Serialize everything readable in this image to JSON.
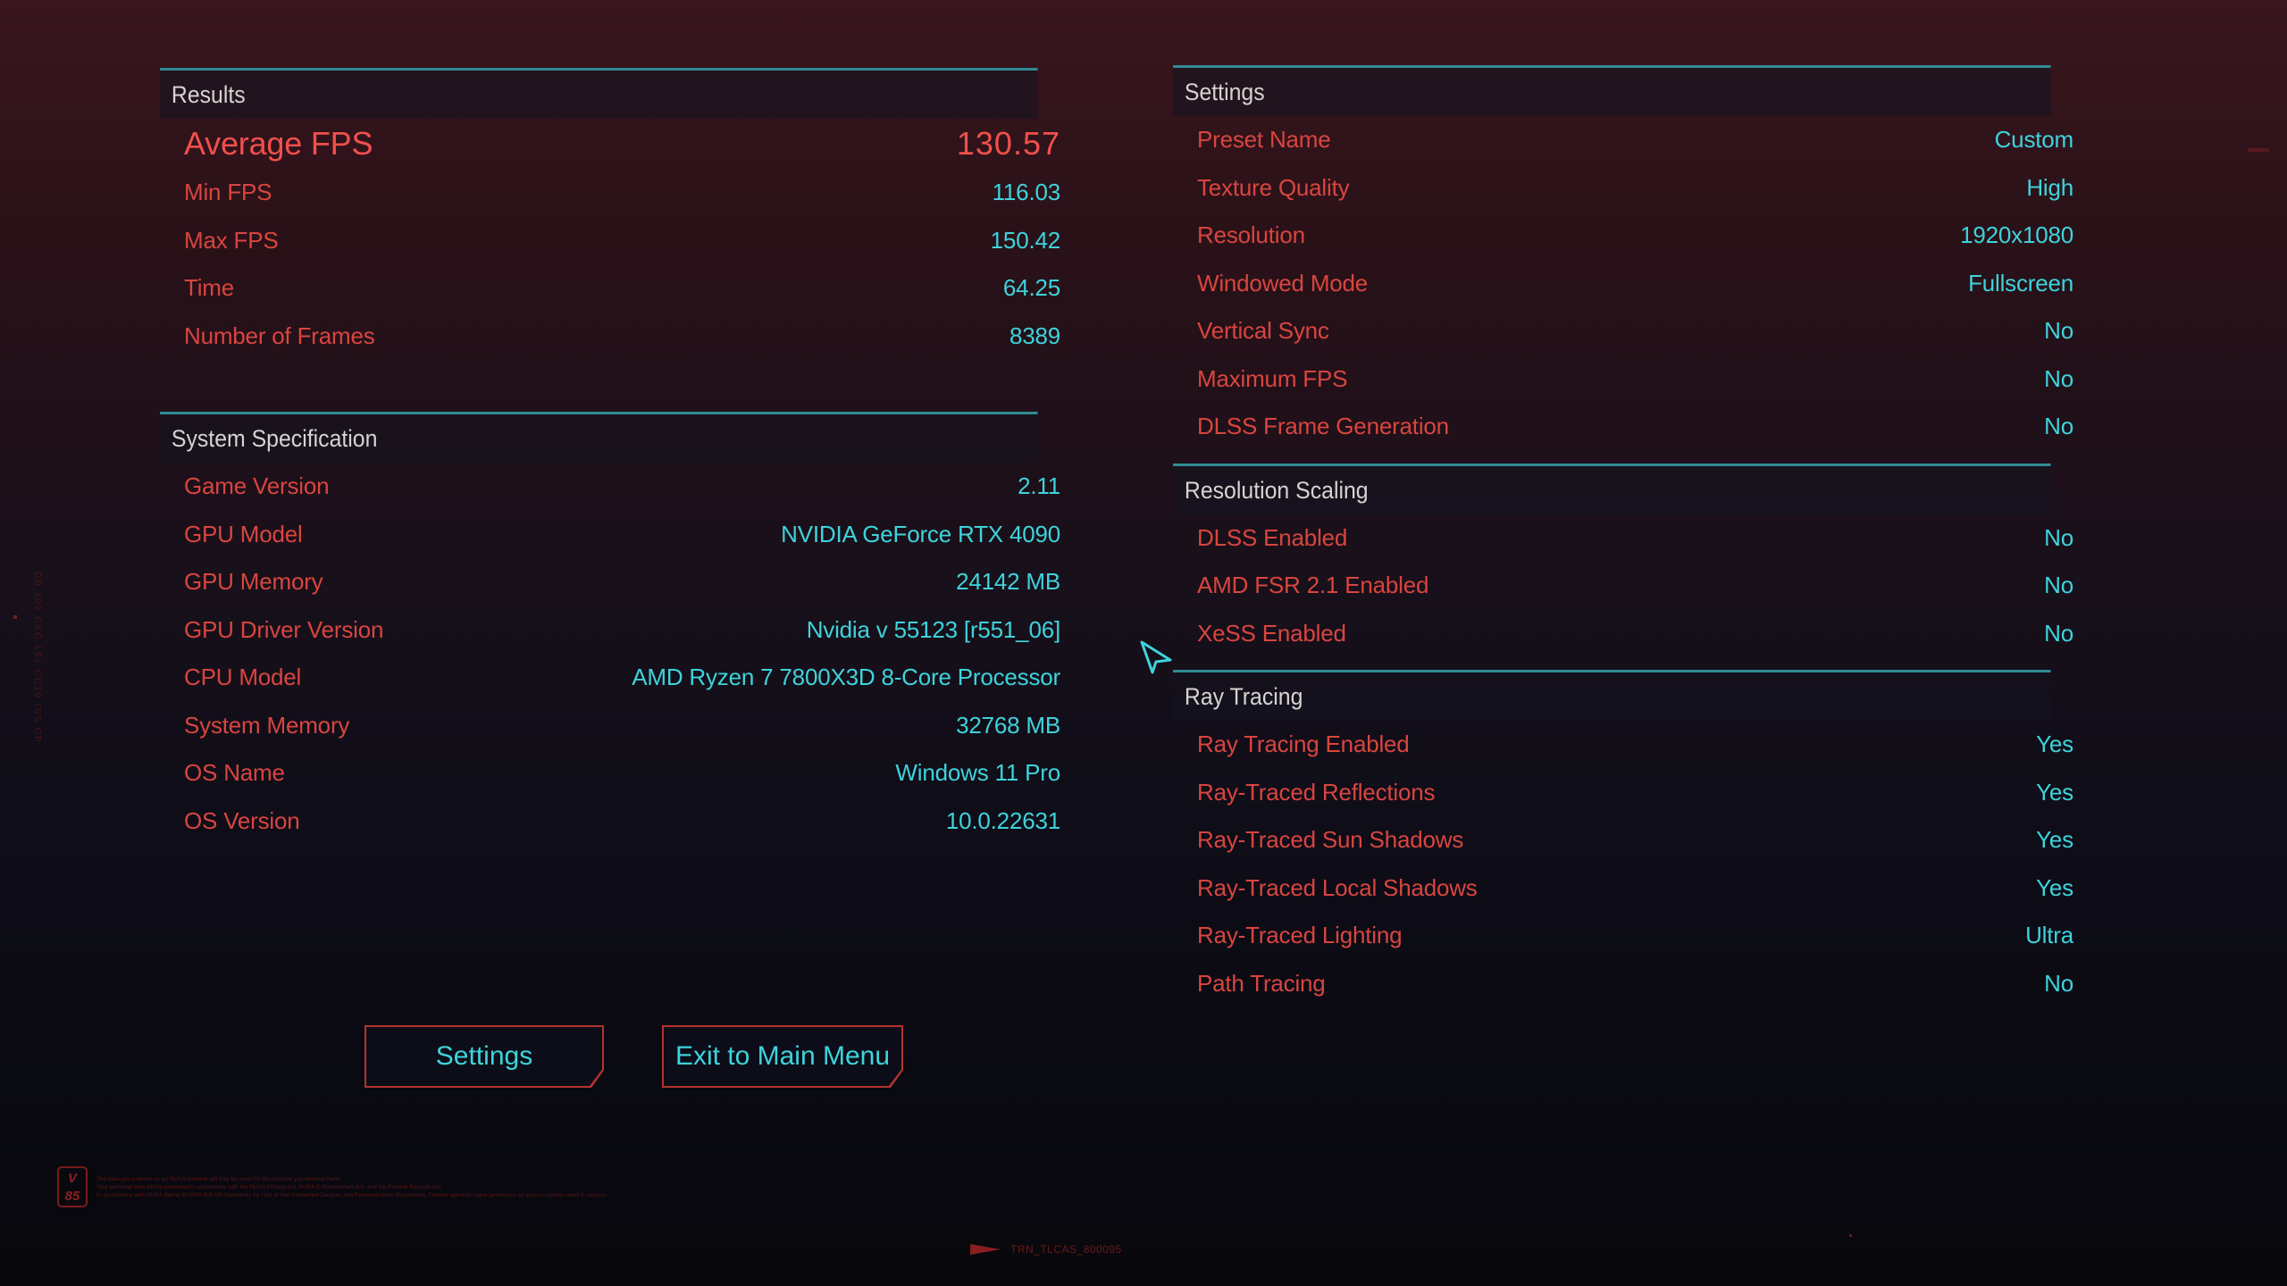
{
  "results": {
    "header": "Results",
    "average_fps": {
      "label": "Average FPS",
      "value": "130.57"
    },
    "rows": [
      {
        "label": "Min FPS",
        "value": "116.03"
      },
      {
        "label": "Max FPS",
        "value": "150.42"
      },
      {
        "label": "Time",
        "value": "64.25"
      },
      {
        "label": "Number of Frames",
        "value": "8389"
      }
    ]
  },
  "system": {
    "header": "System Specification",
    "rows": [
      {
        "label": "Game Version",
        "value": "2.11"
      },
      {
        "label": "GPU Model",
        "value": "NVIDIA GeForce RTX 4090"
      },
      {
        "label": "GPU Memory",
        "value": "24142 MB"
      },
      {
        "label": "GPU Driver Version",
        "value": "Nvidia v 55123 [r551_06]"
      },
      {
        "label": "CPU Model",
        "value": "AMD Ryzen 7 7800X3D 8-Core Processor"
      },
      {
        "label": "System Memory",
        "value": "32768 MB"
      },
      {
        "label": "OS Name",
        "value": "Windows 11 Pro"
      },
      {
        "label": "OS Version",
        "value": "10.0.22631"
      }
    ]
  },
  "settings": {
    "header": "Settings",
    "rows": [
      {
        "label": "Preset Name",
        "value": "Custom"
      },
      {
        "label": "Texture Quality",
        "value": "High"
      },
      {
        "label": "Resolution",
        "value": "1920x1080"
      },
      {
        "label": "Windowed Mode",
        "value": "Fullscreen"
      },
      {
        "label": "Vertical Sync",
        "value": "No"
      },
      {
        "label": "Maximum FPS",
        "value": "No"
      },
      {
        "label": "DLSS Frame Generation",
        "value": "No"
      }
    ]
  },
  "resolution_scaling": {
    "header": "Resolution Scaling",
    "rows": [
      {
        "label": "DLSS Enabled",
        "value": "No"
      },
      {
        "label": "AMD FSR 2.1 Enabled",
        "value": "No"
      },
      {
        "label": "XeSS Enabled",
        "value": "No"
      }
    ]
  },
  "ray_tracing": {
    "header": "Ray Tracing",
    "rows": [
      {
        "label": "Ray Tracing Enabled",
        "value": "Yes"
      },
      {
        "label": "Ray-Traced Reflections",
        "value": "Yes"
      },
      {
        "label": "Ray-Traced Sun Shadows",
        "value": "Yes"
      },
      {
        "label": "Ray-Traced Local Shadows",
        "value": "Yes"
      },
      {
        "label": "Ray-Traced Lighting",
        "value": "Ultra"
      },
      {
        "label": "Path Tracing",
        "value": "No"
      }
    ]
  },
  "buttons": {
    "settings": "Settings",
    "exit": "Exit to Main Menu"
  },
  "footer": {
    "badge_top": "V",
    "badge_bottom": "85",
    "legal_lines": [
      "The data you entered on an NUSA terminal will only be used for the purpose you entered them.",
      "Your personal data will be protected in accordance with the NUSA Privacy Act, NUSA E-Government Act, and the Federal Records Act.",
      "In accordance with NUSA Memo M-0000-000 NS Guidelines for Use of Net-Connected Devices and Personalization Procedures, Federal agencies have permission to access cookies used in session."
    ],
    "code": "TRN_TLCAS_800095",
    "vertical_code": "DB 102 CKC 151 CC10 ISS CP"
  },
  "colors": {
    "label": "#d9453f",
    "value": "#3ed3dc",
    "accent_line": "#2f8c93",
    "button_border": "#b3332e"
  }
}
